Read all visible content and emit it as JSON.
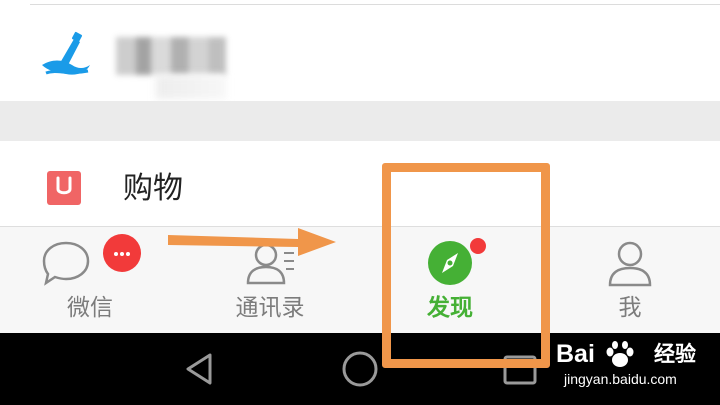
{
  "list": {
    "items": [
      {
        "label": "",
        "icon": "drift-bottle-icon"
      },
      {
        "label": "购物",
        "icon": "shopping-bag-icon"
      }
    ]
  },
  "tabbar": {
    "tabs": [
      {
        "label": "微信",
        "icon": "chat-bubble-icon",
        "active": false,
        "badge": "more-dots"
      },
      {
        "label": "通讯录",
        "icon": "contacts-icon",
        "active": false
      },
      {
        "label": "发现",
        "icon": "compass-icon",
        "active": true,
        "badge": "red-dot"
      },
      {
        "label": "我",
        "icon": "person-icon",
        "active": false
      }
    ]
  },
  "navbar": {
    "buttons": [
      "back-icon",
      "home-icon",
      "recent-apps-icon"
    ]
  },
  "watermark": {
    "brand": "Bai",
    "brand_cn": "经验",
    "url": "jingyan.baidu.com"
  },
  "colors": {
    "active_green": "#45b035",
    "badge_red": "#f23a3a",
    "shopping_red": "#f06565",
    "annotation_orange": "#f0964a",
    "drift_blue": "#1a9be8"
  }
}
